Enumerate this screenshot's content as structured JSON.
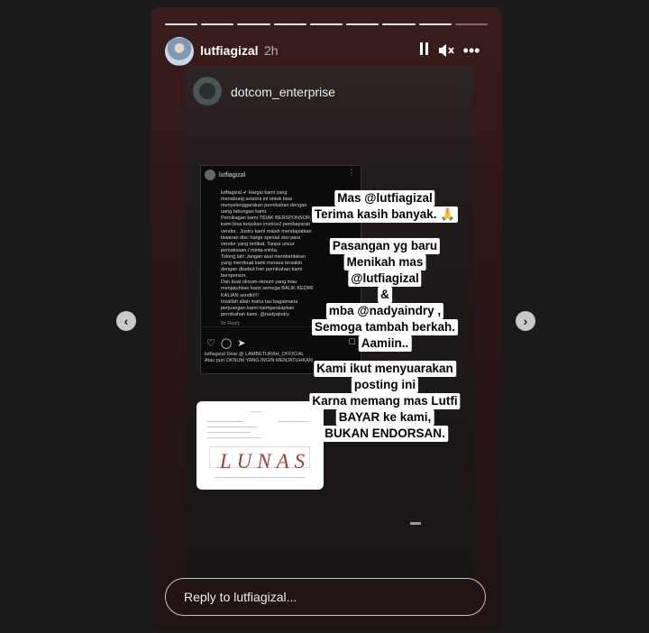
{
  "story": {
    "username": "lutfiagizal",
    "time": "2h",
    "segments_total": 9,
    "segments_viewed": 8
  },
  "shared": {
    "username": "dotcom_enterprise"
  },
  "post": {
    "username": "lutfiagizal",
    "body": [
      "lutfiagizal ✔ Hargai kami yang",
      "menabung selama ini untuk bisa",
      "menyelenggarakan pernikahan dengan",
      "uang tabungan kami.",
      "Pernikagan kami TIDAK BERSPONSOR,",
      "kami bisa tunjukan invoice2 pembayaran",
      "vendor.. Justru kami malah mendapatkan",
      "tawaran disc harga spesial dari para",
      "vendor yang terlibat. Tanpa unsur",
      "pemaksaan / minta-minta.",
      "Tolong lah! Jangan asal memberitakan",
      "yang membuat kami merasa tersakiti",
      "dengan disebut hari pernikahan kami",
      "bersponsor.",
      "Dan buat oknum-oknum yang mau",
      "menjatuhkan kami semoga BALIK KEDIRI",
      "KALIAN sendiri!!!",
      "Insallah allah maha tau bagaimana",
      "perjuangan kami mempersiapkan",
      "pernikahan kami. @nadyaindry"
    ],
    "meta": "5s   Reply",
    "comment": [
      "lutfiagizal Dear @ LAMBETURAH_OFFICIAL",
      "Atau pun OKNUM YANG INGIN MENJATUHKAN"
    ]
  },
  "invoice": {
    "stamp": "LUNAS"
  },
  "caption": [
    {
      "text": "Mas @lutfiagizal"
    },
    {
      "text": "Terima kasih banyak. 🙏"
    },
    {
      "text": "Pasangan yg baru"
    },
    {
      "text": "Menikah mas"
    },
    {
      "text": "@lutfiagizal"
    },
    {
      "text": "&"
    },
    {
      "text": "mba @nadyaindry ,"
    },
    {
      "text": "Semoga tambah berkah."
    },
    {
      "text": "Aamiin.."
    },
    {
      "text": "Kami ikut menyuarakan"
    },
    {
      "text": "posting ini"
    },
    {
      "text": "Karna memang mas Lutfi"
    },
    {
      "text": "BAYAR ke kami,"
    },
    {
      "text": "BUKAN ENDORSAN."
    }
  ],
  "reply": {
    "placeholder": "Reply to lutfiagizal..."
  },
  "icons": {
    "pause": "pause-icon",
    "mute": "speaker-muted-icon",
    "more": "more-icon",
    "prev": "chevron-left-icon",
    "next": "chevron-right-icon"
  }
}
